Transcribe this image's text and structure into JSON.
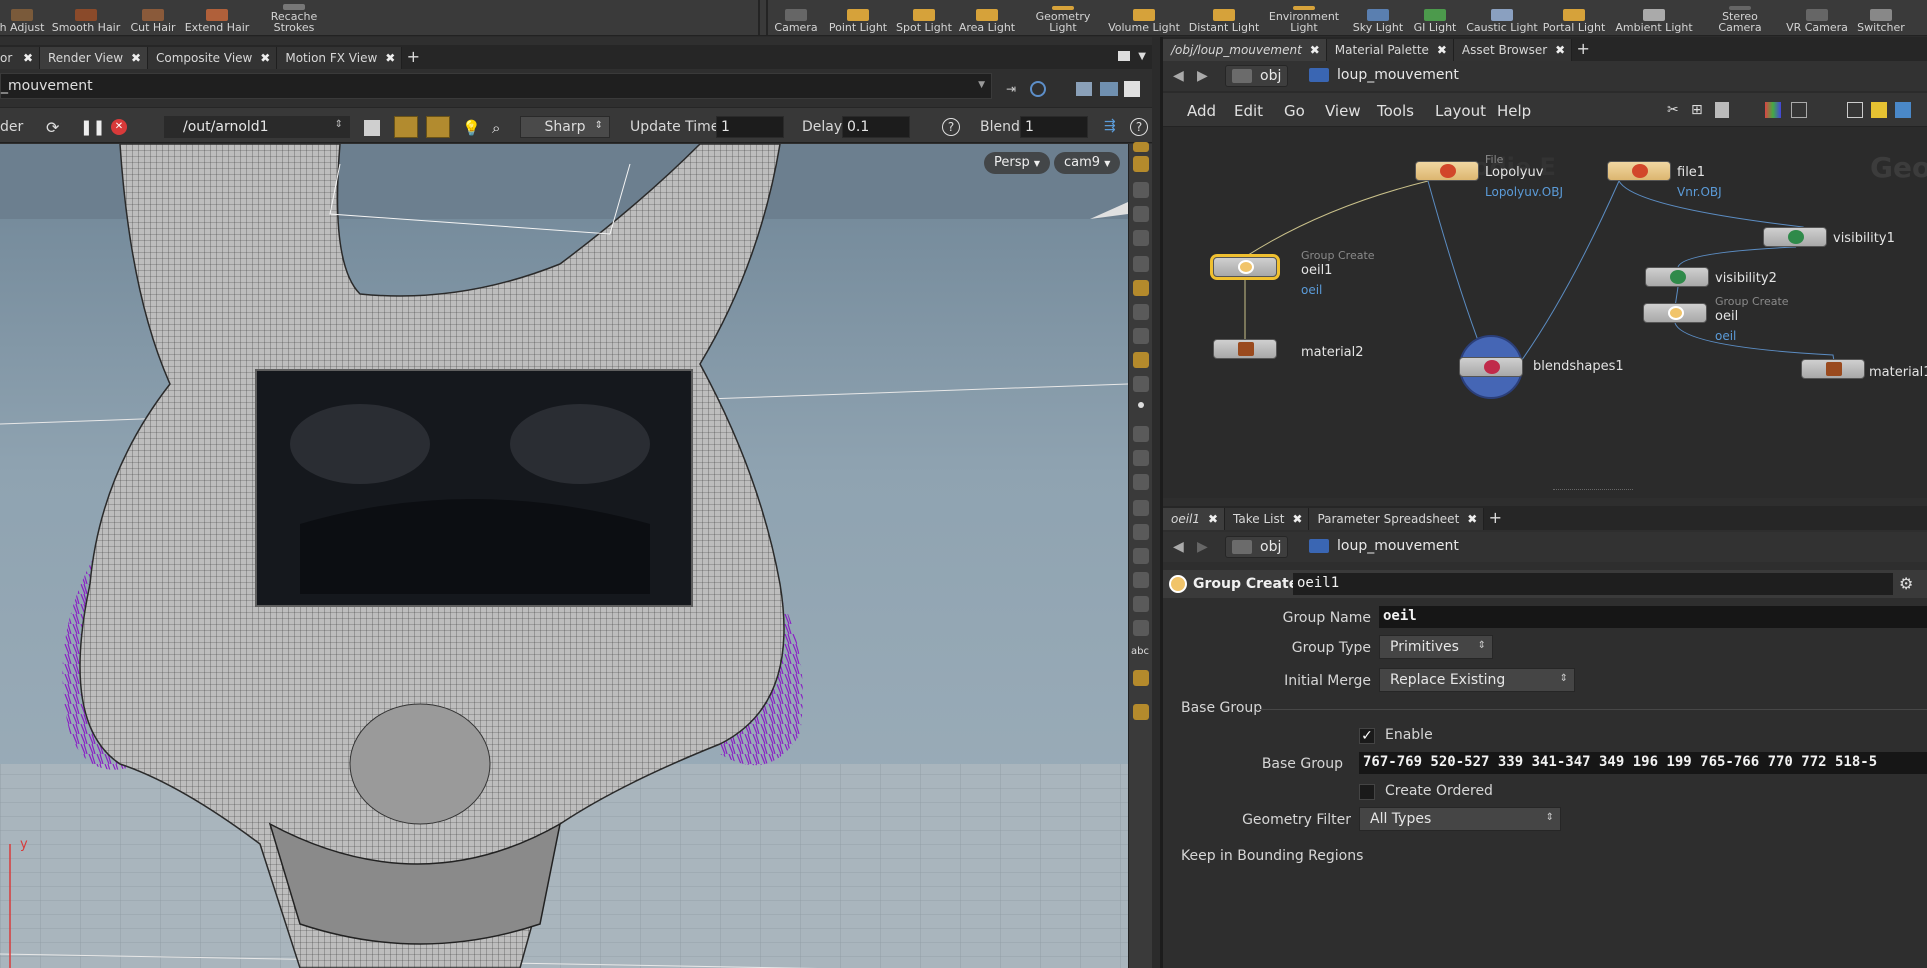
{
  "shelf": {
    "left_tools": [
      "h Adjust",
      "Smooth Hair",
      "Cut Hair",
      "Extend Hair",
      "Recache\nStrokes"
    ],
    "right_tools": [
      "Camera",
      "Point Light",
      "Spot Light",
      "Area Light",
      "Geometry\nLight",
      "Volume Light",
      "Distant Light",
      "Environment\nLight",
      "Sky Light",
      "GI Light",
      "Caustic Light",
      "Portal Light",
      "Ambient Light",
      "Stereo\nCamera",
      "VR Camera",
      "Switcher"
    ]
  },
  "left_tabs": [
    "or",
    "Render View",
    "Composite View",
    "Motion FX View"
  ],
  "left_path": "_mouvement",
  "render_toolbar": {
    "render_label": "der",
    "rop_path": "/out/arnold1",
    "sharpness": "Sharp",
    "update_time_label": "Update Time",
    "update_time_value": "1",
    "delay_label": "Delay",
    "delay_value": "0.1",
    "blend_label": "Blend",
    "blend_value": "1",
    "help_glyph": "?"
  },
  "viewport": {
    "view_menu": "Persp",
    "camera_menu": "cam9",
    "axis_label": "y"
  },
  "right_tabs": [
    "/obj/loup_mouvement",
    "Material Palette",
    "Asset Browser"
  ],
  "network_path": {
    "context": "obj",
    "node": "loup_mouvement"
  },
  "network_menu": [
    "Add",
    "Edit",
    "Go",
    "View",
    "Tools",
    "Layout",
    "Help"
  ],
  "network_watermark": "Geo",
  "network_bg_text": "odie E",
  "nodes": {
    "lopolyuv": {
      "type": "File",
      "name": "Lopolyuv",
      "sub": "Lopolyuv.OBJ"
    },
    "file1": {
      "name": "file1",
      "sub": "Vnr.OBJ"
    },
    "visibility1": {
      "name": "visibility1"
    },
    "visibility2": {
      "name": "visibility2"
    },
    "oeil1": {
      "type": "Group Create",
      "name": "oeil1",
      "sub": "oeil"
    },
    "oeil": {
      "type": "Group Create",
      "name": "oeil",
      "sub": "oeil"
    },
    "material2": {
      "name": "material2"
    },
    "blendshapes1": {
      "name": "blendshapes1"
    },
    "material1": {
      "name": "material1"
    }
  },
  "param_tabs": [
    "oeil1",
    "Take List",
    "Parameter Spreadsheet"
  ],
  "param_path": {
    "context": "obj",
    "node": "loup_mouvement"
  },
  "params": {
    "node_type": "Group Create",
    "node_name": "oeil1",
    "group_name_label": "Group Name",
    "group_name": "oeil",
    "group_type_label": "Group Type",
    "group_type": "Primitives",
    "initial_merge_label": "Initial Merge",
    "initial_merge": "Replace Existing",
    "base_group_section": "Base Group",
    "enable_label": "Enable",
    "enable_checked": true,
    "base_group_label": "Base Group",
    "base_group_value": "767-769 520-527 339 341-347 349 196 199 765-766 770 772 518-5",
    "create_ordered_label": "Create Ordered",
    "geometry_filter_label": "Geometry Filter",
    "geometry_filter": "All Types",
    "bounding_section": "Keep in Bounding Regions"
  },
  "colors": {
    "accent": "#f0c030",
    "link_blue": "#5b9bd8",
    "hair_purple": "#8a1fc4"
  }
}
